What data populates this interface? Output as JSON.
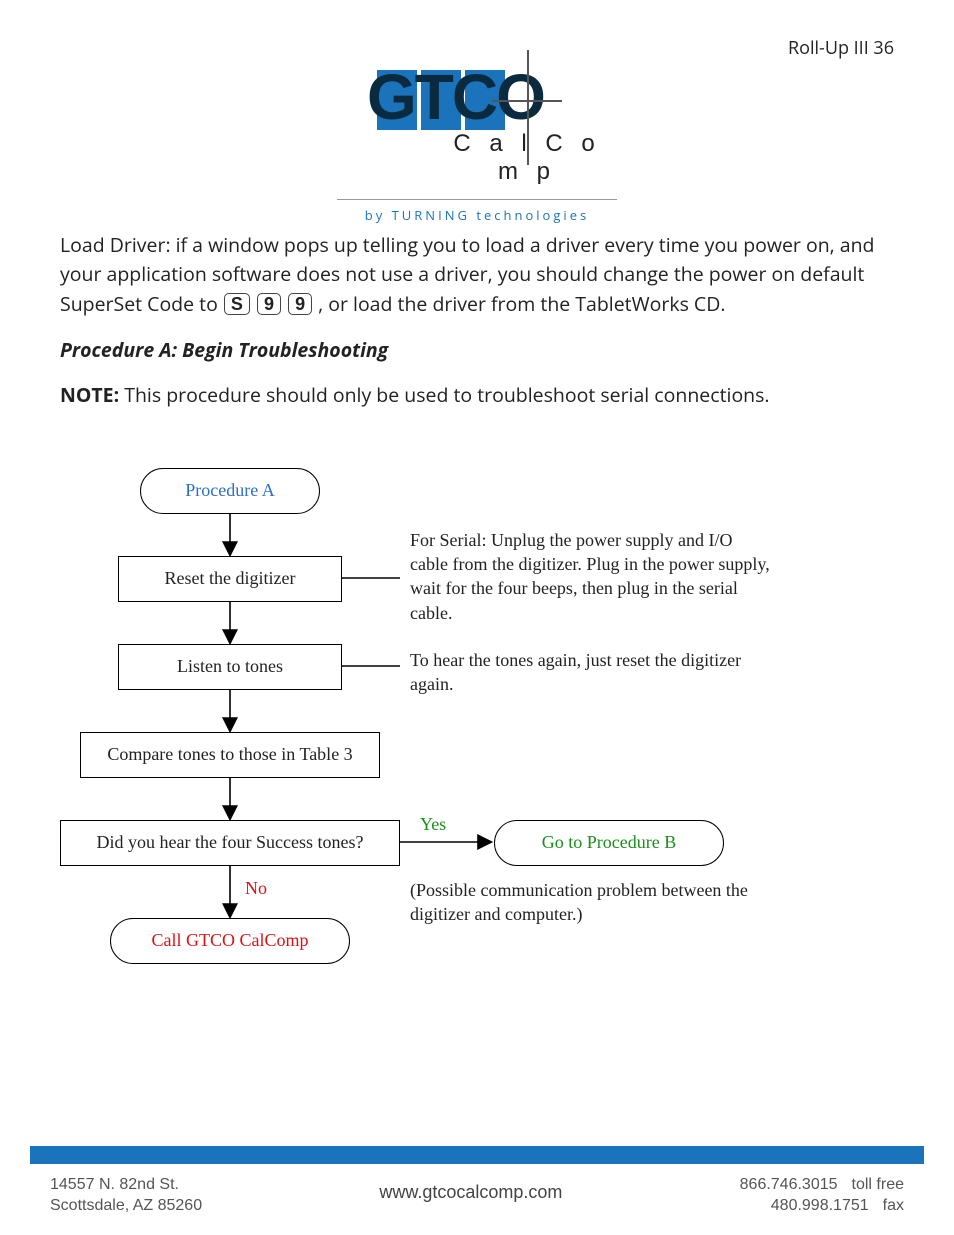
{
  "header": {
    "page_label": "Roll-Up III 36"
  },
  "logo": {
    "gtco": "GTCO",
    "calcomp": "C a l C o m p",
    "byline": "by  TURNING  technologies"
  },
  "body": {
    "load_driver_pre": "Load Driver: if a window pops up telling you to load a driver every time you power on, and your application software does not use a driver, you should change the power on default SuperSet Code to ",
    "key1": "S",
    "key2": "9",
    "key3": "9",
    "load_driver_post": ", or load the driver from the TabletWorks CD.",
    "proc_title": "Procedure A: Begin Troubleshooting",
    "note_label": "NOTE:",
    "note_text": " This procedure should only be used to troubleshoot serial connections."
  },
  "flow": {
    "start": "Procedure A",
    "step1": "Reset the digitizer",
    "side1": "For Serial:  Unplug the power supply and I/O cable from the digitizer. Plug in the power supply, wait for the four beeps, then plug in the serial cable.",
    "step2": "Listen to tones",
    "side2": "To hear the tones again, just reset the digitizer again.",
    "step3": "Compare tones to those in Table 3",
    "decision": "Did you hear the four Success tones?",
    "yes": "Yes",
    "no": "No",
    "yes_target": "Go to Procedure B",
    "yes_side": "(Possible communication problem between the digitizer and computer.)",
    "no_target": "Call GTCO CalComp"
  },
  "footer": {
    "addr1": "14557 N. 82nd St.",
    "addr2": "Scottsdale, AZ 85260",
    "url": "www.gtcocalcomp.com",
    "phone1": "866.746.3015",
    "phone1_lbl": "toll free",
    "phone2": "480.998.1751",
    "phone2_lbl": "fax"
  }
}
